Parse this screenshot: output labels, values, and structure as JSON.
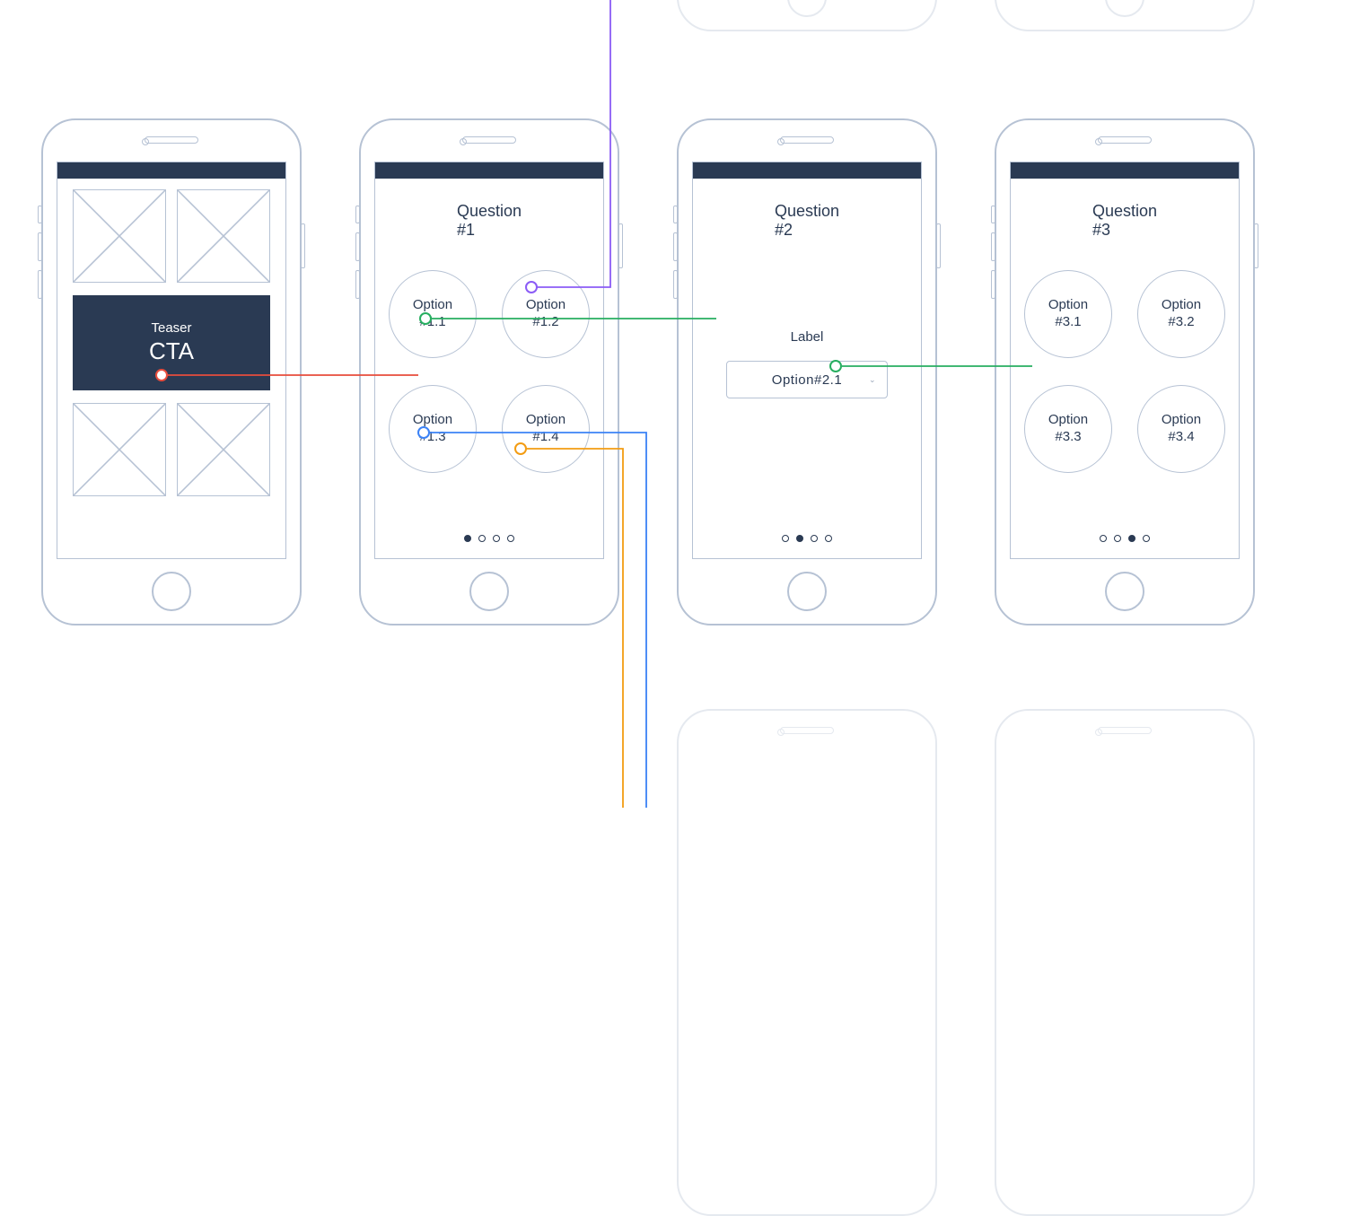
{
  "phone1": {
    "teaser": "Teaser",
    "cta": "CTA"
  },
  "phone2": {
    "title": "Question #1",
    "options": [
      "Option #1.1",
      "Option #1.2",
      "Option #1.3",
      "Option #1.4"
    ],
    "pager": {
      "total": 4,
      "active": 0
    }
  },
  "phone3": {
    "title": "Question #2",
    "label": "Label",
    "dropdown_value": "Option#2.1",
    "pager": {
      "total": 4,
      "active": 1
    }
  },
  "phone4": {
    "title": "Question #3",
    "options": [
      "Option #3.1",
      "Option #3.2",
      "Option #3.3",
      "Option #3.4"
    ],
    "pager": {
      "total": 4,
      "active": 2
    }
  },
  "colors": {
    "connectors": {
      "red": "#e74c3c",
      "purple": "#8b5cf6",
      "green": "#27ae60",
      "blue": "#3b82f6",
      "orange": "#f39c12"
    }
  }
}
